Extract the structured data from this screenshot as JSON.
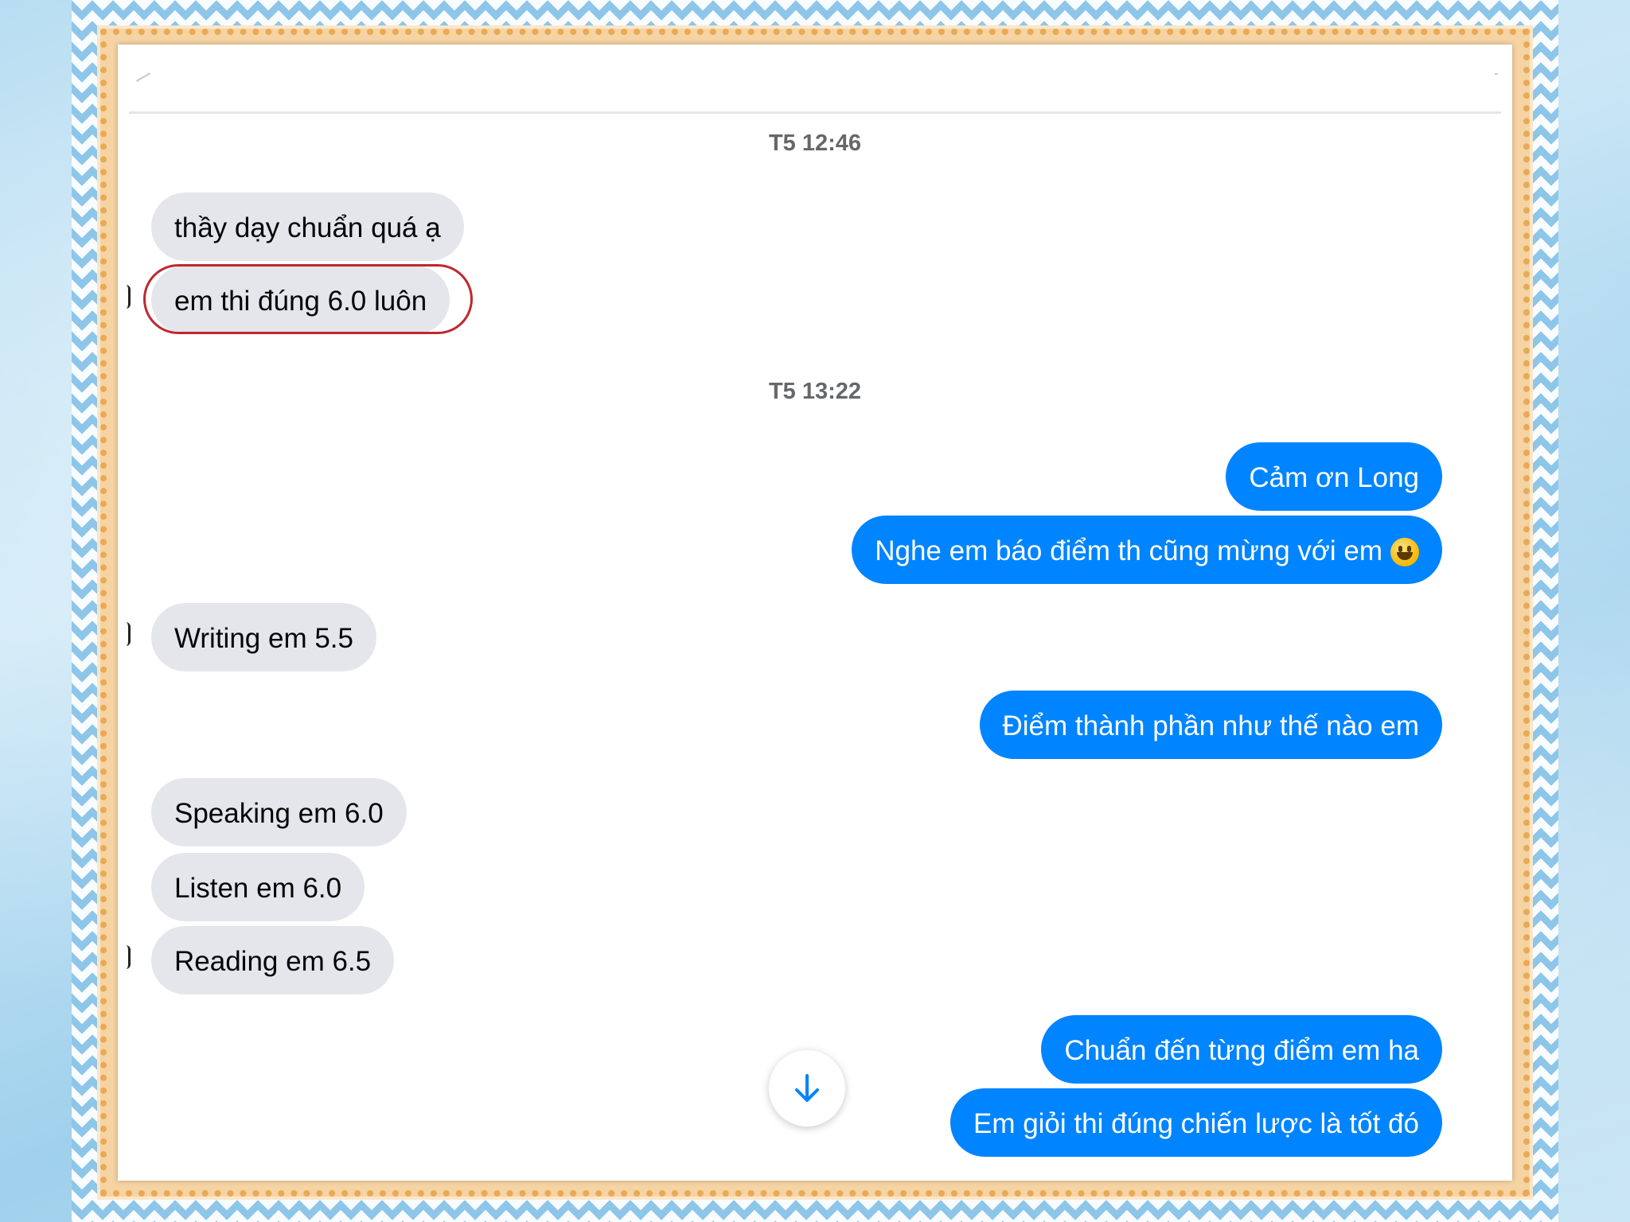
{
  "colors": {
    "incoming_bubble": "#e4e6eb",
    "outgoing_bubble": "#0084ff",
    "highlight_ring": "#c0272d",
    "timestamp_text": "#65676b"
  },
  "conversation": {
    "timestamps": [
      "T5 12:46",
      "T5 13:22"
    ],
    "messages": [
      {
        "sender": "other",
        "text": "thầy dạy chuẩn quá ạ"
      },
      {
        "sender": "other",
        "text": "em thi đúng 6.0 luôn",
        "highlighted": true
      },
      {
        "sender": "me",
        "text": "Cảm ơn Long"
      },
      {
        "sender": "me",
        "text": "Nghe em báo điểm th cũng mừng với em",
        "emoji": "grinning-face-emoji"
      },
      {
        "sender": "other",
        "text": "Writing em 5.5"
      },
      {
        "sender": "me",
        "text": "Điểm thành phần như thế nào em"
      },
      {
        "sender": "other",
        "text": "Speaking em 6.0"
      },
      {
        "sender": "other",
        "text": "Listen em 6.0"
      },
      {
        "sender": "other",
        "text": "Reading em 6.5"
      },
      {
        "sender": "me",
        "text": "Chuẩn đến từng điểm em ha"
      },
      {
        "sender": "me",
        "text": "Em giỏi thi đúng chiến lược là tốt đó"
      }
    ]
  },
  "icons": {
    "scroll_down": "arrow-down-icon"
  }
}
